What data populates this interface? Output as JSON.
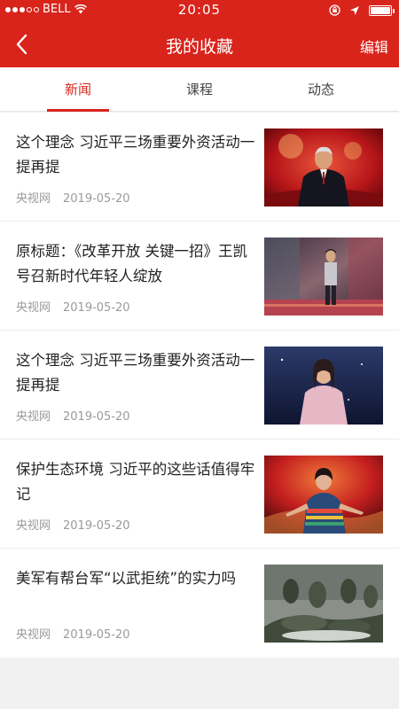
{
  "status_bar": {
    "carrier": "BELL",
    "time": "20:05"
  },
  "nav": {
    "back_icon": "chevron-left-icon",
    "title": "我的收藏",
    "edit_label": "编辑"
  },
  "tabs": [
    {
      "label": "新闻",
      "active": true
    },
    {
      "label": "课程",
      "active": false
    },
    {
      "label": "动态",
      "active": false
    }
  ],
  "colors": {
    "brand": "#d9241b",
    "meta_text": "#9a9a9a",
    "background": "#f1f1f1"
  },
  "news": [
    {
      "title": "这个理念 习近平三场重要外资活动一提再提",
      "source": "央视网",
      "date": "2019-05-20"
    },
    {
      "title": "原标题：《改革开放 关键一招》王凯号召新时代年轻人绽放",
      "source": "央视网",
      "date": "2019-05-20"
    },
    {
      "title": "这个理念 习近平三场重要外资活动一提再提",
      "source": "央视网",
      "date": "2019-05-20"
    },
    {
      "title": "保护生态环境 习近平的这些话值得牢记",
      "source": "央视网",
      "date": "2019-05-20"
    },
    {
      "title": "美军有帮台军“以武拒统”的实力吗",
      "source": "央视网",
      "date": "2019-05-20"
    }
  ]
}
